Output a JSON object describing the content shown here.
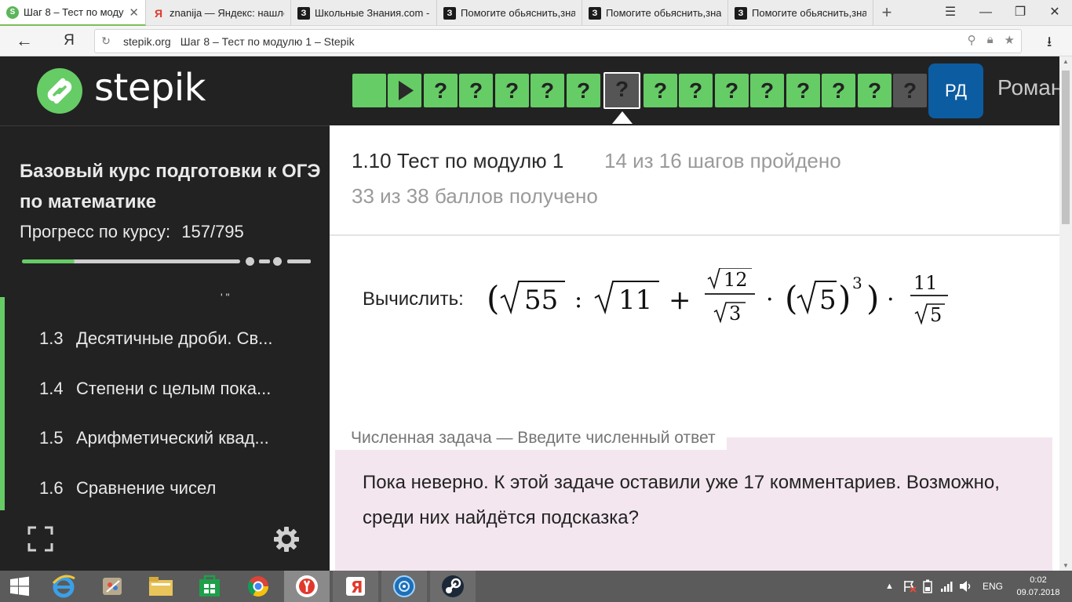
{
  "browser": {
    "tabs": [
      {
        "label": "Шаг 8 – Тест по моду",
        "icon": "stepik-favicon",
        "active": true
      },
      {
        "label": "znanija — Яндекс: нашло",
        "icon": "yandex-favicon",
        "active": false
      },
      {
        "label": "Школьные Знания.com -",
        "icon": "znanija-favicon",
        "active": false
      },
      {
        "label": "Помогите обьяснить,зна",
        "icon": "znanija-favicon",
        "active": false
      },
      {
        "label": "Помогите обьяснить,зна",
        "icon": "znanija-favicon",
        "active": false
      },
      {
        "label": "Помогите обьяснить,зна",
        "icon": "znanija-favicon",
        "active": false
      }
    ],
    "url_domain": "stepik.org",
    "url_title": "Шаг 8 – Тест по модулю 1 – Stepik",
    "yandex_glyph": "Я"
  },
  "header": {
    "logo_text": "stepik",
    "steps": [
      {
        "label": "",
        "state": "done"
      },
      {
        "label": "▶",
        "state": "video"
      },
      {
        "label": "?",
        "state": "done"
      },
      {
        "label": "?",
        "state": "done"
      },
      {
        "label": "?",
        "state": "done"
      },
      {
        "label": "?",
        "state": "done"
      },
      {
        "label": "?",
        "state": "done"
      },
      {
        "label": "?",
        "state": "current"
      },
      {
        "label": "?",
        "state": "done"
      },
      {
        "label": "?",
        "state": "done"
      },
      {
        "label": "?",
        "state": "done"
      },
      {
        "label": "?",
        "state": "done"
      },
      {
        "label": "?",
        "state": "done"
      },
      {
        "label": "?",
        "state": "done"
      },
      {
        "label": "?",
        "state": "done"
      },
      {
        "label": "?",
        "state": "pending"
      }
    ],
    "avatar_initials": "РД",
    "user_name": "Роман"
  },
  "sidebar": {
    "course_title": "Базовый курс подготовки к ОГЭ по математике",
    "progress_label": "Прогресс по курсу:",
    "progress_value": "157/795",
    "progress_fraction": 0.1975,
    "quote_mark": "' \"",
    "lessons": [
      {
        "num": "1.3",
        "title": "Десятичные дроби. Св..."
      },
      {
        "num": "1.4",
        "title": "Степени с целым пока..."
      },
      {
        "num": "1.5",
        "title": "Арифметический квад..."
      },
      {
        "num": "1.6",
        "title": "Сравнение чисел"
      }
    ]
  },
  "main": {
    "lesson_title": "1.10 Тест по модулю 1",
    "steps_passed": "14 из 16 шагов пройдено",
    "score": "33 из 38 баллов  получено",
    "task_prefix": "Вычислить:",
    "formula": {
      "sqrt_a": "55",
      "colon": ":",
      "sqrt_b": "11",
      "plus": "+",
      "frac1_num_root": "12",
      "frac1_den_root": "3",
      "dot": "·",
      "sqrt_c": "5",
      "power": "3",
      "frac2_num": "11",
      "frac2_den_root": "5",
      "lparen": "(",
      "rparen": ")"
    },
    "feedback_tab": "Численная задача — Введите численный ответ",
    "feedback_text": "Пока неверно. К этой задаче оставили уже 17 комментариев. Возможно, среди них найдётся подсказка?"
  },
  "taskbar": {
    "language": "ENG",
    "time": "0:02",
    "date": "09.07.2018"
  },
  "colors": {
    "stepik_green": "#66cc66",
    "dark_bg": "#222222",
    "avatar_blue": "#0c5ca1",
    "feedback_bg": "#f3e6ef"
  }
}
